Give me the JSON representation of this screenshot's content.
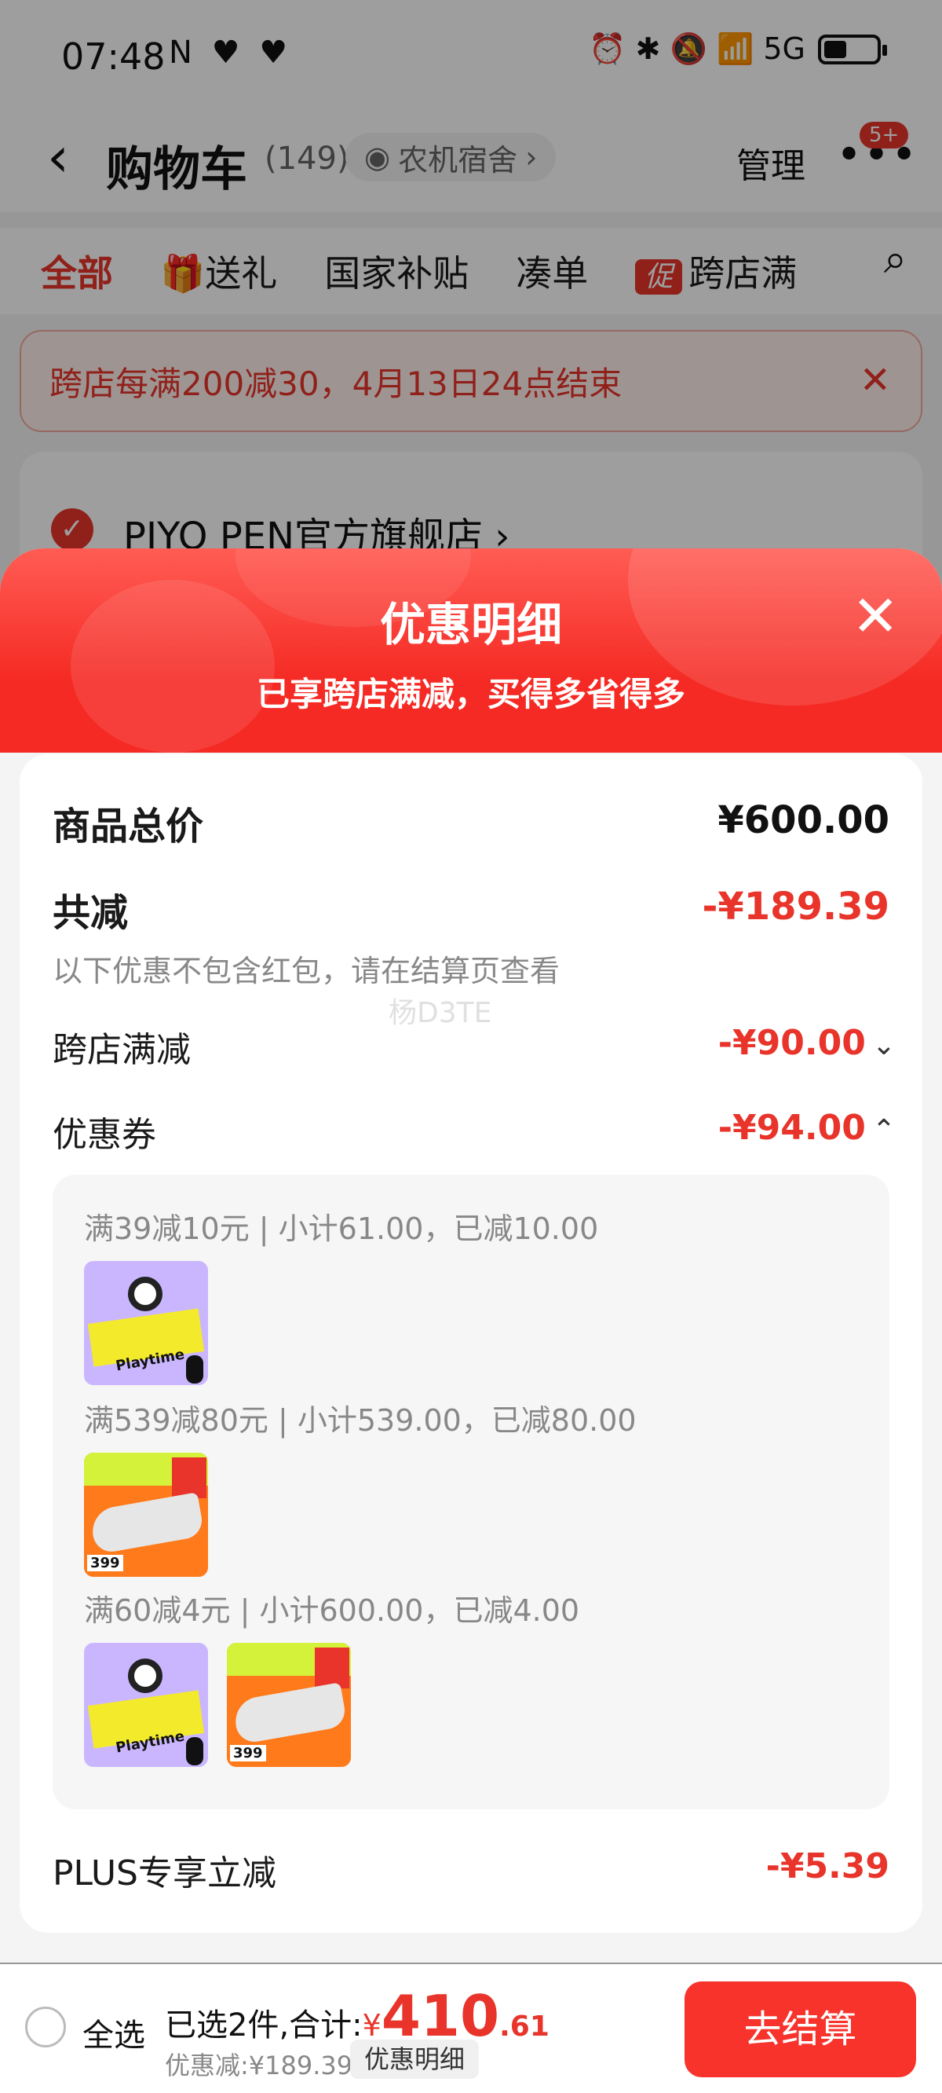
{
  "status_bar": {
    "time": "07:48",
    "left_icons": "N ♥ ♥",
    "right_icons": "⏰ ✱ 🔕 📶 5G"
  },
  "header": {
    "back": "‹",
    "title": "购物车",
    "count": "(149)",
    "address": "农机宿舍",
    "manage": "管理",
    "more": "•••",
    "badge": "5+"
  },
  "tabs": {
    "all": "全部",
    "gift": "送礼",
    "subsidy": "国家补贴",
    "bundle": "凑单",
    "promo_tag": "促",
    "cross_store": "跨店满"
  },
  "banner": {
    "text": "跨店每满200减30，4月13日24点结束",
    "close": "✕"
  },
  "store": {
    "name": "PIYO PEN官方旗舰店 ›"
  },
  "sheet": {
    "title": "优惠明细",
    "subtitle": "已享跨店满减，买得多省得多",
    "close": "✕",
    "watermark": "杨D3TE",
    "total_label": "商品总价",
    "total_value": "¥600.00",
    "reduce_label": "共减",
    "reduce_value": "-¥189.39",
    "reduce_note": "以下优惠不包含红包，请在结算页查看",
    "cross_label": "跨店满减",
    "cross_value": "-¥90.00",
    "coupon_label": "优惠券",
    "coupon_value": "-¥94.00",
    "coupons": [
      {
        "text": "满39减10元 | 小计61.00，已减10.00"
      },
      {
        "text": "满539减80元 | 小计539.00，已减80.00"
      },
      {
        "text": "满60减4元 | 小计600.00，已减4.00"
      }
    ],
    "product_labels": {
      "book": "Playtime",
      "shoe_price": "399"
    },
    "plus_label": "PLUS专享立减",
    "plus_value": "-¥5.39"
  },
  "bottom": {
    "select_all": "全选",
    "selected_text": "已选2件,合计:",
    "yen": "¥",
    "total_int": "410",
    "total_dec": ".61",
    "discount": "优惠减:¥189.39",
    "detail_chip": "优惠明细",
    "checkout": "去结算"
  },
  "colors": {
    "accent": "#e8342a",
    "button": "#f7332c"
  }
}
